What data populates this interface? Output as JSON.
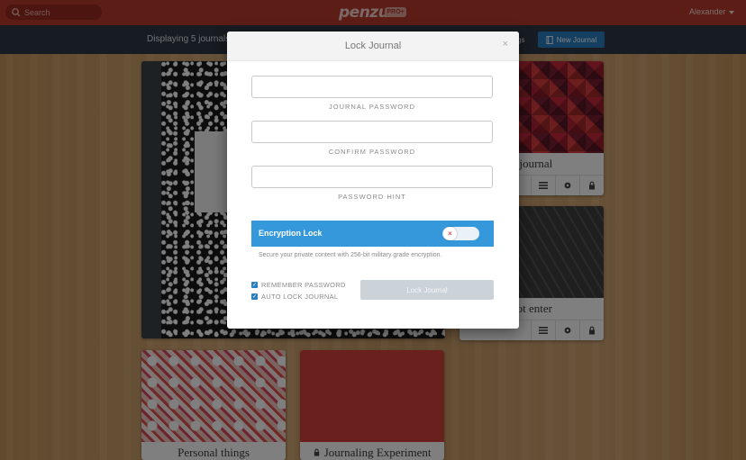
{
  "header": {
    "search_placeholder": "Search",
    "logo": "penzu",
    "badge": "PRO+",
    "user": "Alexander"
  },
  "subbar": {
    "displaying": "Displaying 5 journals",
    "settings_label": "gs",
    "new_journal": "New Journal"
  },
  "journals": [
    {
      "title": "y journal"
    },
    {
      "title": "not enter"
    },
    {
      "title": "Personal things"
    },
    {
      "title": "Journaling Experiment",
      "locked": true
    }
  ],
  "modal": {
    "title": "Lock Journal",
    "close": "×",
    "password_label": "JOURNAL PASSWORD",
    "confirm_label": "CONFIRM PASSWORD",
    "hint_label": "PASSWORD HINT",
    "encryption_label": "Encryption Lock",
    "encryption_state": "off",
    "toggle_x": "×",
    "encryption_desc": "Secure your private content with 256-bit military grade encryption.",
    "remember_password": "REMEMBER PASSWORD",
    "remember_checked": true,
    "auto_lock": "AUTO LOCK JOURNAL",
    "auto_lock_checked": true,
    "lock_button": "Lock Journal"
  },
  "colors": {
    "topbar": "#b83a2e",
    "subbar": "#2f3944",
    "accent": "#3498db",
    "button": "#2a7fc1"
  }
}
